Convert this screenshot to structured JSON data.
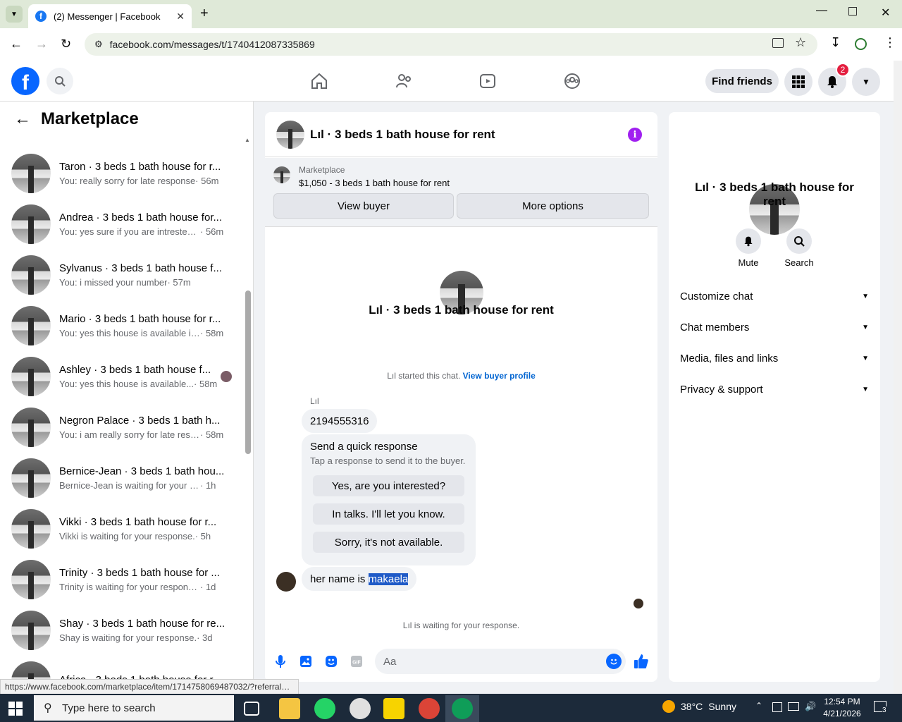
{
  "browser": {
    "tab_title": "(2) Messenger | Facebook",
    "url": "facebook.com/messages/t/1740412087335869",
    "status_link": "https://www.facebook.com/marketplace/item/1714758069487032/?referralS..."
  },
  "header": {
    "find_friends": "Find friends",
    "notification_count": "2"
  },
  "sidebar": {
    "title": "Marketplace",
    "conversations": [
      {
        "name": "Taron · 3 beds 1 bath house for r...",
        "message": "You: really sorry for late response",
        "time": "· 56m"
      },
      {
        "name": "Andrea · 3 beds 1 bath house for...",
        "message": "You: yes sure if you are intrested ...",
        "time": "· 56m"
      },
      {
        "name": "Sylvanus · 3 beds 1 bath house f...",
        "message": "You: i missed your number",
        "time": "· 57m"
      },
      {
        "name": "Mario · 3 beds 1 bath house for r...",
        "message": "You: yes this house is available if ...",
        "time": "· 58m"
      },
      {
        "name": "Ashley · 3 beds 1 bath house f...",
        "message": "You: yes this house is available...",
        "time": "· 58m"
      },
      {
        "name": "Negron Palace · 3 beds 1 bath h...",
        "message": "You: i am really sorry for late resp...",
        "time": "· 58m"
      },
      {
        "name": "Bernice-Jean · 3 beds 1 bath hou...",
        "message": "Bernice-Jean is waiting for your res...",
        "time": "· 1h"
      },
      {
        "name": "Vikki · 3 beds 1 bath house for r...",
        "message": "Vikki is waiting for your response.",
        "time": "· 5h"
      },
      {
        "name": "Trinity · 3 beds 1 bath house for ...",
        "message": "Trinity is waiting for your response.",
        "time": "· 1d"
      },
      {
        "name": "Shay · 3 beds 1 bath house for re...",
        "message": "Shay is waiting for your response.",
        "time": "· 3d"
      },
      {
        "name": "Africa · 3 beds 1 bath house for r...",
        "message": "",
        "time": ""
      }
    ]
  },
  "chat": {
    "title": "Lıl · 3 beds 1 bath house for rent",
    "marketplace_label": "Marketplace",
    "listing": "$1,050 - 3 beds 1 bath house for rent",
    "view_buyer": "View buyer",
    "more_options": "More options",
    "center_name": "Lıl · 3 beds 1 bath house for rent",
    "started_text": "Lıl started this chat.",
    "view_buyer_profile": "View buyer profile",
    "sender": "Lıl",
    "phone_message": "2194555316",
    "quick_title": "Send a quick response",
    "quick_sub": "Tap a response to send it to the buyer.",
    "quick_options": [
      "Yes, are you interested?",
      "In talks. I'll let you know.",
      "Sorry, it's not available."
    ],
    "her_message_prefix": "her name is ",
    "her_message_selected": "makaela",
    "waiting": "Lıl is waiting for your response.",
    "composer_placeholder": "Aa"
  },
  "right_panel": {
    "name": "Lıl · 3 beds 1 bath house for rent",
    "mute": "Mute",
    "search": "Search",
    "rows": [
      "Customize chat",
      "Chat members",
      "Media, files and links",
      "Privacy & support"
    ]
  },
  "taskbar": {
    "search_placeholder": "Type here to search",
    "temperature": "38°C",
    "weather": "Sunny",
    "time": "12:54 PM",
    "date": "4/21/2026",
    "notif_count": "3"
  },
  "colors": {
    "fb_blue": "#0866ff",
    "accent_purple": "#a020f0",
    "notification_red": "#e41e3f"
  }
}
